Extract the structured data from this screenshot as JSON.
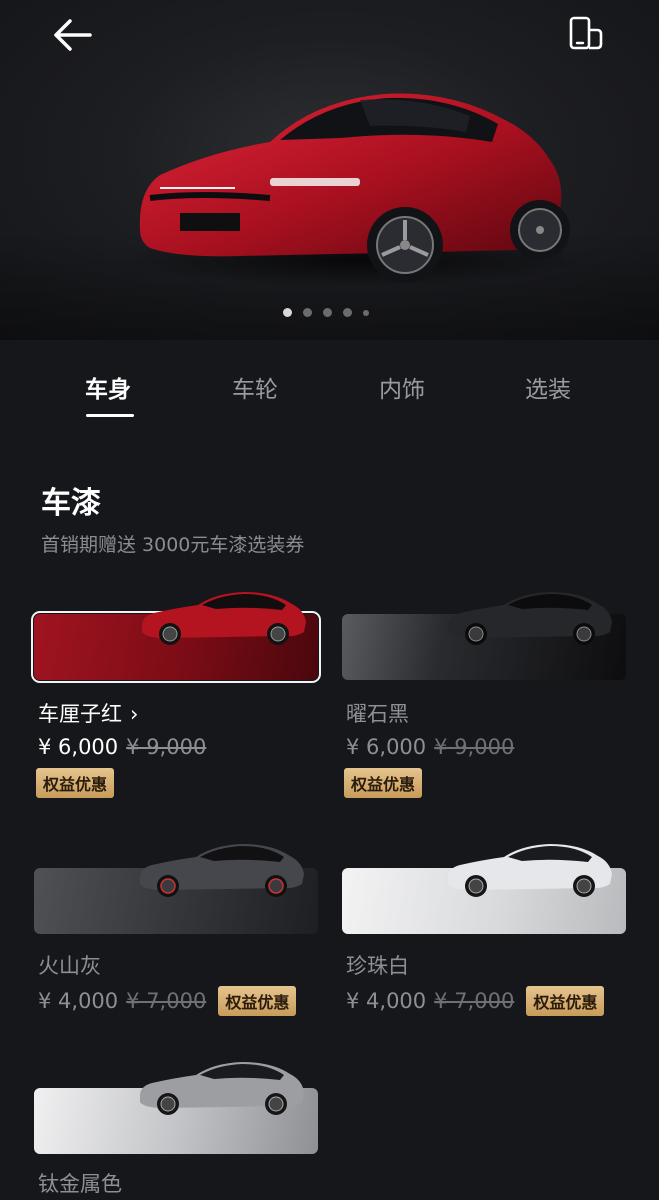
{
  "header": {
    "back_icon": "arrow-left-icon",
    "phone_icon": "phone-side-icon"
  },
  "hero": {
    "slide_count": 5,
    "active_slide": 1
  },
  "tabs": [
    {
      "label": "车身",
      "active": true
    },
    {
      "label": "车轮",
      "active": false
    },
    {
      "label": "内饰",
      "active": false
    },
    {
      "label": "选装",
      "active": false
    }
  ],
  "paint": {
    "title": "车漆",
    "subtitle": "首销期赠送 3000元车漆选装券",
    "options": [
      {
        "name": "车厘子红",
        "price": "¥ 6,000",
        "old_price": "¥ 9,000",
        "badge": "权益优惠",
        "selected": true,
        "color": "#8c1219"
      },
      {
        "name": "曜石黑",
        "price": "¥ 6,000",
        "old_price": "¥ 9,000",
        "badge": "权益优惠",
        "selected": false,
        "color": "#1b1c20"
      },
      {
        "name": "火山灰",
        "price": "¥ 4,000",
        "old_price": "¥ 7,000",
        "badge": "权益优惠",
        "selected": false,
        "color": "#3a3b3f"
      },
      {
        "name": "珍珠白",
        "price": "¥ 4,000",
        "old_price": "¥ 7,000",
        "badge": "权益优惠",
        "selected": false,
        "color": "#dcdde0"
      },
      {
        "name": "钛金属色",
        "selected": false,
        "color": "#9a9ca0"
      }
    ]
  },
  "colors": {
    "accent_badge": "#d4ad6e",
    "background": "#16171b"
  }
}
